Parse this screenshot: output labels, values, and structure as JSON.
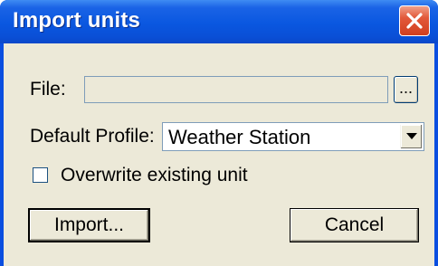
{
  "window": {
    "title": "Import units",
    "close_icon": "close-icon"
  },
  "form": {
    "file_label": "File:",
    "file_value": "",
    "browse_label": "...",
    "profile_label": "Default Profile:",
    "profile_value": "Weather Station",
    "dropdown_icon": "chevron-down-icon",
    "overwrite_label": "Overwrite existing unit",
    "overwrite_checked": false
  },
  "buttons": {
    "import_label": "Import...",
    "cancel_label": "Cancel"
  },
  "colors": {
    "titlebar": "#0a57e0",
    "close_button": "#d13f1f",
    "dialog_background": "#ece9d8",
    "field_border": "#7f9db9"
  }
}
